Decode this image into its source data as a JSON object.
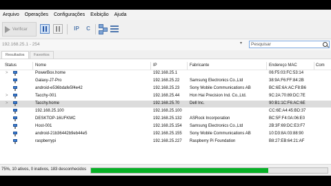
{
  "menu": [
    "Arquivo",
    "Operações",
    "Configurações",
    "Exibição",
    "Ajuda"
  ],
  "toolbar": {
    "scan_label": "Verificar",
    "ip_label": "IP",
    "c_label": "C"
  },
  "address": {
    "range": "192.168.25.1 - 254",
    "search_placeholder": "Pesquisar"
  },
  "tabs": [
    "Resultados",
    "Favoritos"
  ],
  "columns": {
    "status": "Status",
    "name": "Nome",
    "ip": "IP",
    "maker": "Fabricante",
    "mac": "Endereço MAC",
    "comments": "Com"
  },
  "rows": [
    {
      "name": "PowerBox.home",
      "ip": "192.168.25.1",
      "maker": "",
      "mac": "06:F5:03:FC:53:14",
      "expander": ">"
    },
    {
      "name": "Galaxy-J7-Pro",
      "ip": "192.168.25.22",
      "maker": "Samsung Electronics Co.,Ltd",
      "mac": "38:9A:F6:FF:84:2B",
      "expander": ""
    },
    {
      "name": "android-e536bdafe5f4e42",
      "ip": "192.168.25.23",
      "maker": "Sony Mobile Communications AB",
      "mac": "BC:6E:6A:AC:F8:B6",
      "expander": ""
    },
    {
      "name": "Tacchy-001",
      "ip": "192.168.25.44",
      "maker": "Hon Hai Precision Ind. Co.,Ltd.",
      "mac": "9C:2A:70:89:DC:7E",
      "expander": ">"
    },
    {
      "name": "Tacchy.home",
      "ip": "192.168.25.70",
      "maker": "Dell Inc.",
      "mac": "90:B1:1C:F6:AC:6E",
      "expander": ">"
    },
    {
      "name": "192.168.25.100",
      "ip": "192.168.25.100",
      "maker": "",
      "mac": "CC:6E:A4:45:BD:37",
      "expander": ""
    },
    {
      "name": "DESKTOP-16UFKMC",
      "ip": "192.168.25.132",
      "maker": "ASRock Incorporation",
      "mac": "BC:5F:F4:0A:06:E0",
      "expander": ""
    },
    {
      "name": "Host-001",
      "ip": "192.168.25.154",
      "maker": "Samsung Electronics Co.,Ltd",
      "mac": "2B:3F:69:DC:E3:F7",
      "expander": ""
    },
    {
      "name": "android-21b36442b9eb44e5",
      "ip": "192.168.25.155",
      "maker": "Sony Mobile Communications AB",
      "mac": "10:D3:8A:03:88:90",
      "expander": ""
    },
    {
      "name": "raspberrypi",
      "ip": "192.168.25.227",
      "maker": "Raspberry Pi Foundation",
      "mac": "B8:27:EB:64:21:AF",
      "expander": ""
    }
  ],
  "selected_index": 4,
  "statusbar": {
    "text": "75%, 10 ativos, 0 inativos, 183 desconhecidos",
    "progress_percent": 75
  },
  "colors": {
    "progress": "#06b025",
    "selection": "#dcdcdc",
    "accent": "#3b7fd4"
  }
}
